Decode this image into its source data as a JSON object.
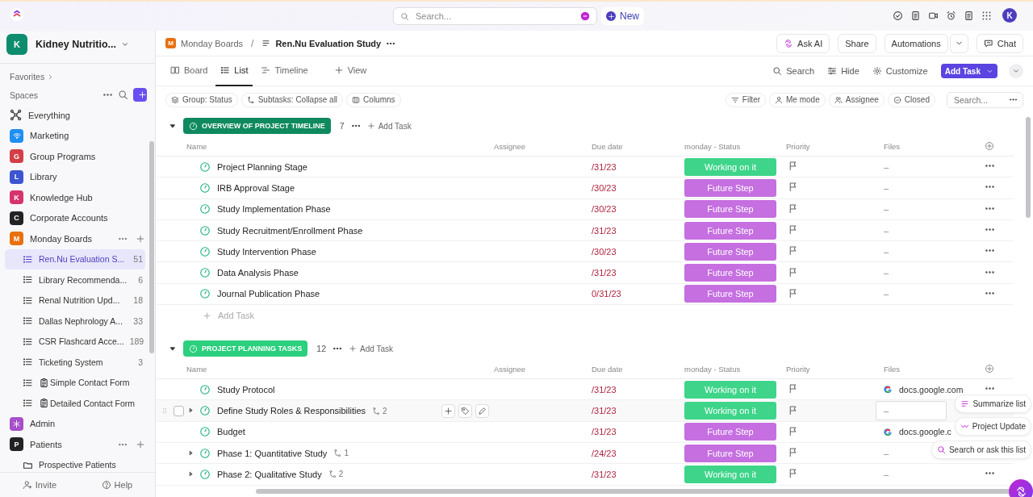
{
  "topbar": {
    "search_placeholder": "Search...",
    "new_button": "New",
    "avatar": "K"
  },
  "workspace": {
    "initial": "K",
    "name": "Kidney Nutritio...",
    "color": "#0e8c6e"
  },
  "sidebar": {
    "favorites": "Favorites",
    "spaces_label": "Spaces",
    "items": [
      {
        "kind": "everything",
        "label": "Everything"
      },
      {
        "kind": "wifi",
        "label": "Marketing",
        "color": "#1f8ef1"
      },
      {
        "kind": "letter",
        "initial": "G",
        "label": "Group Programs",
        "color": "#d23f45"
      },
      {
        "kind": "letter",
        "initial": "L",
        "label": "Library",
        "color": "#3d55d0"
      },
      {
        "kind": "letter",
        "initial": "K",
        "label": "Knowledge Hub",
        "color": "#d6336c"
      },
      {
        "kind": "letter",
        "initial": "C",
        "label": "Corporate Accounts",
        "color": "#222222"
      },
      {
        "kind": "letter",
        "initial": "M",
        "label": "Monday Boards",
        "color": "#e8700e",
        "actions": true,
        "children": [
          {
            "kind": "list",
            "label": "Ren.Nu Evaluation S...",
            "count": "51",
            "selected": true
          },
          {
            "kind": "list",
            "label": "Library Recommenda...",
            "count": "6",
            "selected": false
          },
          {
            "kind": "list",
            "label": "Renal Nutrition Upd...",
            "count": "18",
            "selected": false
          },
          {
            "kind": "list",
            "label": "Dallas Nephrology A...",
            "count": "33",
            "selected": false
          },
          {
            "kind": "list",
            "label": "CSR Flashcard Acce...",
            "count": "189",
            "selected": false
          },
          {
            "kind": "list",
            "label": "Ticketing System",
            "count": "3",
            "selected": false
          },
          {
            "kind": "form",
            "label": "Simple Contact Form",
            "selected": false
          },
          {
            "kind": "form",
            "label": "Detailed Contact Form",
            "selected": false
          }
        ]
      },
      {
        "kind": "snow",
        "label": "Admin",
        "color": "#a64fc9"
      },
      {
        "kind": "letter",
        "initial": "P",
        "label": "Patients",
        "color": "#222222",
        "actions": true,
        "children": [
          {
            "kind": "folder",
            "label": "Prospective Patients",
            "selected": false
          }
        ]
      }
    ],
    "footer": [
      "Invite",
      "Help"
    ]
  },
  "breadcrumb": {
    "space_initial": "M",
    "space": "Monday Boards",
    "separator": "/",
    "list": "Ren.Nu Evaluation Study"
  },
  "header_actions": [
    "Ask AI",
    "Share",
    "Automations",
    "Chat"
  ],
  "views": [
    {
      "label": "Board",
      "kind": "board",
      "selected": false
    },
    {
      "label": "List",
      "kind": "list",
      "selected": true
    },
    {
      "label": "Timeline",
      "kind": "timeline",
      "selected": false
    },
    {
      "label": "View",
      "kind": "add",
      "selected": false
    }
  ],
  "view_actions": {
    "search": "Search",
    "hide": "Hide",
    "customize": "Customize",
    "add_task": "Add Task"
  },
  "filters_left": [
    "Group: Status",
    "Subtasks: Collapse all",
    "Columns"
  ],
  "filters_right": [
    "Filter",
    "Me mode",
    "Assignee",
    "Closed"
  ],
  "filter_search_placeholder": "Search...",
  "groups": [
    {
      "name": "OVERVIEW OF PROJECT TIMELINE",
      "color": "#0f8a5f",
      "count": "7",
      "add_task": "Add Task",
      "footer_add": "Add Task",
      "columns": [
        "Name",
        "Assignee",
        "Due date",
        "monday - Status",
        "Priority",
        "Files"
      ],
      "tasks": [
        {
          "name": "Project Planning Stage",
          "due": "/31/23",
          "status": {
            "label": "Working on it",
            "color": "#3ed58a"
          },
          "file": "–"
        },
        {
          "name": "IRB Approval Stage",
          "due": "/30/23",
          "status": {
            "label": "Future Step",
            "color": "#c56fe0"
          },
          "file": "–"
        },
        {
          "name": "Study Implementation Phase",
          "due": "/30/23",
          "status": {
            "label": "Future Step",
            "color": "#c56fe0"
          },
          "file": "–"
        },
        {
          "name": "Study Recruitment/Enrollment Phase",
          "due": "/31/23",
          "status": {
            "label": "Future Step",
            "color": "#c56fe0"
          },
          "file": "–"
        },
        {
          "name": "Study Intervention Phase",
          "due": "/30/23",
          "status": {
            "label": "Future Step",
            "color": "#c56fe0"
          },
          "file": "–"
        },
        {
          "name": "Data Analysis Phase",
          "due": "/31/23",
          "status": {
            "label": "Future Step",
            "color": "#c56fe0"
          },
          "file": "–"
        },
        {
          "name": "Journal Publication Phase",
          "due": "0/31/23",
          "status": {
            "label": "Future Step",
            "color": "#c56fe0"
          },
          "file": "–"
        }
      ]
    },
    {
      "name": "PROJECT PLANNING TASKS",
      "color": "#2bcf7e",
      "count": "12",
      "add_task": "Add Task",
      "columns": [
        "Name",
        "Assignee",
        "Due date",
        "monday - Status",
        "Priority",
        "Files"
      ],
      "tasks": [
        {
          "name": "Study Protocol",
          "due": "/31/23",
          "status": {
            "label": "Working on it",
            "color": "#3ed58a"
          },
          "file": {
            "kind": "google",
            "label": "docs.google.com"
          }
        },
        {
          "name": "Define Study Roles & Responsibilities",
          "subtasks": "2",
          "expandable": true,
          "hovered": true,
          "due": "/31/23",
          "status": {
            "label": "Working on it",
            "color": "#3ed58a"
          },
          "file": "–"
        },
        {
          "name": "Budget",
          "covered": true,
          "due": "/31/23",
          "status": {
            "label": "Future Step",
            "color": "#c56fe0"
          },
          "file": {
            "kind": "google",
            "label": "docs.google.c"
          }
        },
        {
          "name": "Phase 1: Quantitative Study",
          "covered": true,
          "subtasks": "1",
          "expandable": true,
          "due": "/24/23",
          "status": {
            "label": "Future Step",
            "color": "#c56fe0"
          },
          "file": "–"
        },
        {
          "name": "Phase 2: Qualitative Study",
          "subtasks": "2",
          "expandable": true,
          "due": "/31/23",
          "status": {
            "label": "Working on it",
            "color": "#3ed58a"
          },
          "file": "–"
        }
      ]
    }
  ],
  "ai_menu": [
    "Summarize list",
    "Project Update",
    "Search or ask this list"
  ]
}
